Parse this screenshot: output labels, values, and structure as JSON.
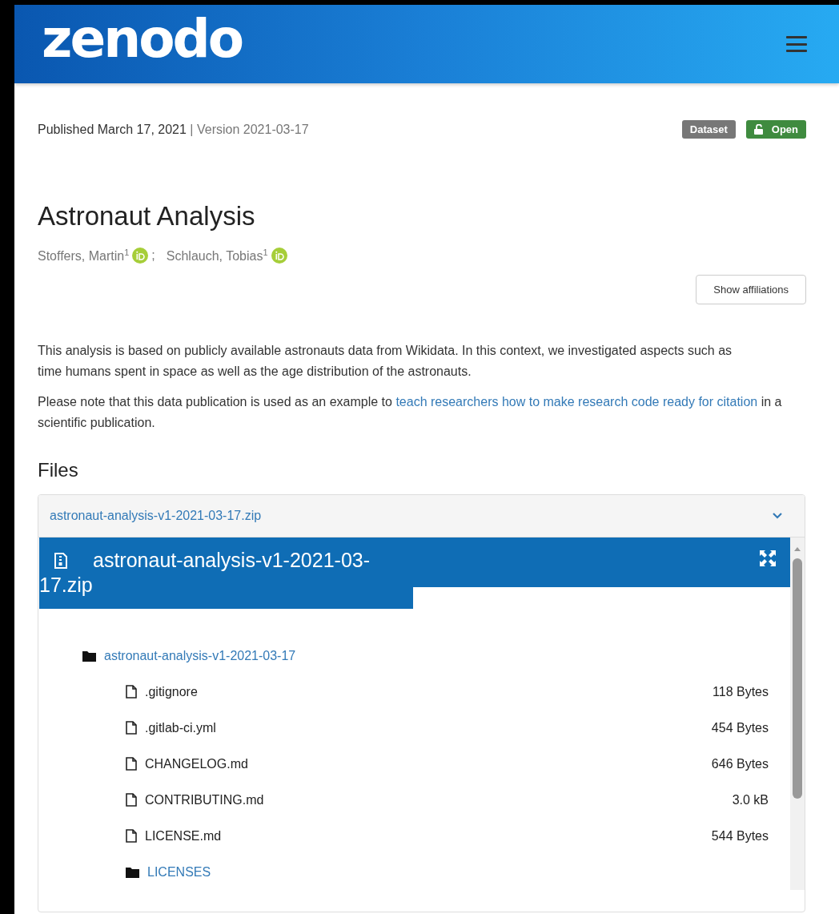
{
  "header": {
    "logo": "zenodo"
  },
  "meta": {
    "published": "Published March 17, 2021",
    "separator": "|",
    "version": "Version 2021-03-17",
    "badges": [
      {
        "kind": "type",
        "label": "Dataset",
        "color": "#777777"
      },
      {
        "kind": "access",
        "label": "Open",
        "color": "#3f8b3f"
      }
    ]
  },
  "title": "Astronaut Analysis",
  "authors": [
    {
      "name": "Stoffers, Martin$^{1}$",
      "separator": ";"
    },
    {
      "name": "Schlauch, Tobias$^{1}$"
    }
  ],
  "affiliations_button": "Show affiliations",
  "description": [
    {
      "text": "This analysis is based on publicly available astronauts data from Wikidata. In this context, we investigated aspects such as time humans spent in space as well as the age distribution of the astronauts."
    },
    {
      "text": "Please note that this data publication is used as an example to ",
      "link": "teach researchers how to make research code ready for citation",
      "after": " in a scientific publication."
    }
  ],
  "files": {
    "heading": "Files",
    "panel_title": "astronaut-analysis-v1-2021-03-17.zip",
    "expanded": true,
    "preview_title": "astronaut-analysis-v1-2021-03-17.zip",
    "tree": [
      {
        "kind": "folder",
        "name": "astronaut-analysis-v1-2021-03-17",
        "children": [
          {
            "kind": "file",
            "name": ".gitignore",
            "size": "118 Bytes"
          },
          {
            "kind": "file",
            "name": ".gitlab-ci.yml",
            "size": "454 Bytes"
          },
          {
            "kind": "file",
            "name": "CHANGELOG.md",
            "size": "646 Bytes"
          },
          {
            "kind": "file",
            "name": "CONTRIBUTING.md",
            "size": "3.0 kB"
          },
          {
            "kind": "file",
            "name": "LICENSE.md",
            "size": "544 Bytes"
          },
          {
            "kind": "folder",
            "name": "LICENSES"
          }
        ]
      }
    ]
  }
}
